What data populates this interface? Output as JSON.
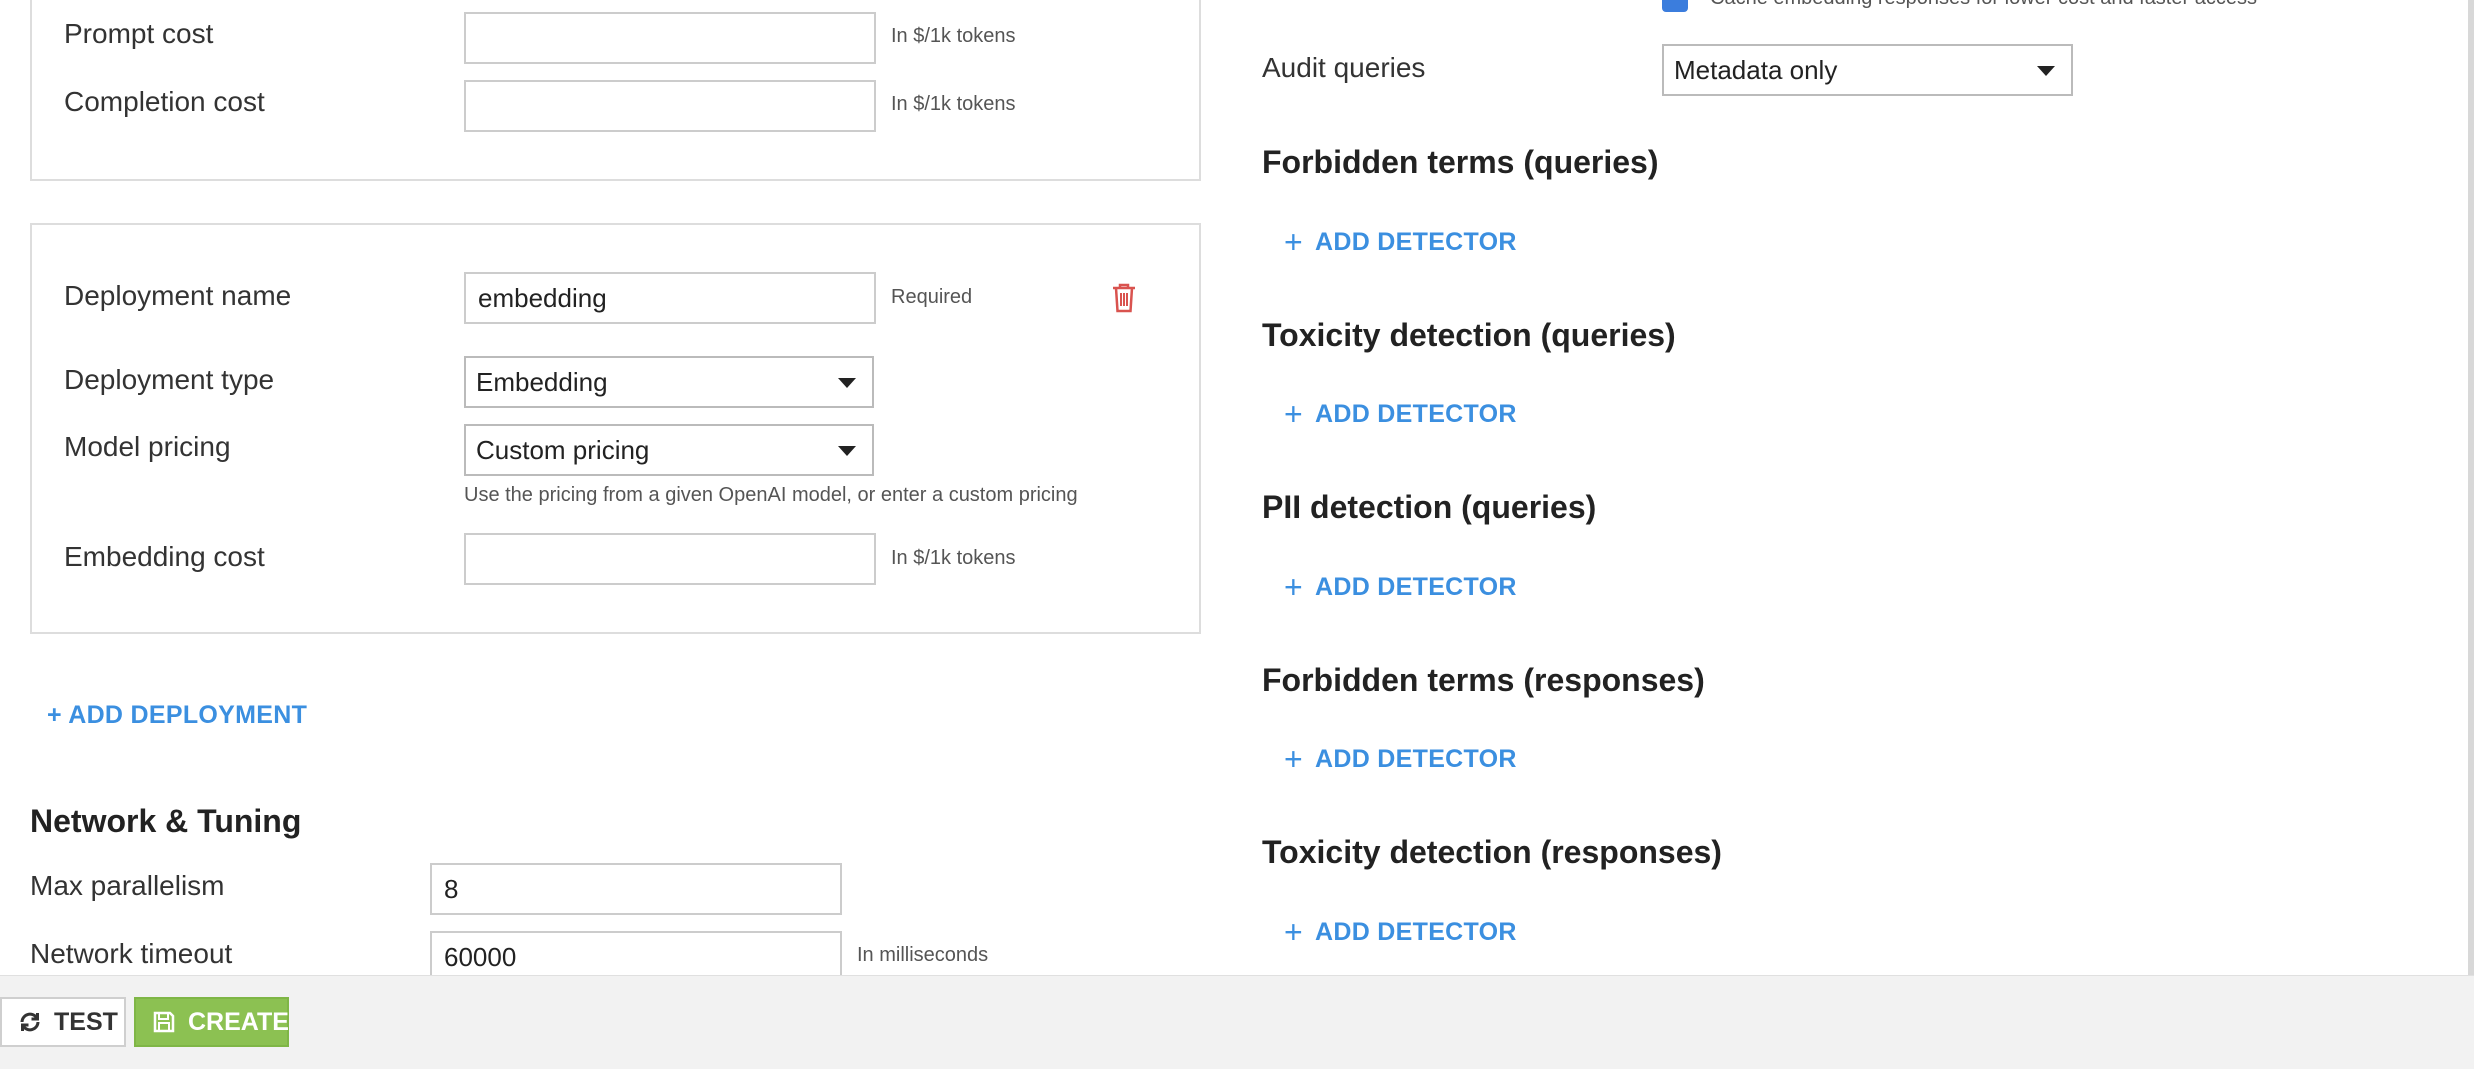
{
  "pricing_top": {
    "prompt_cost_label": "Prompt cost",
    "prompt_cost_value": "",
    "prompt_cost_hint": "In $/1k tokens",
    "completion_cost_label": "Completion cost",
    "completion_cost_value": "",
    "completion_cost_hint": "In $/1k tokens"
  },
  "deployment": {
    "name_label": "Deployment name",
    "name_value": "embedding",
    "name_hint": "Required",
    "type_label": "Deployment type",
    "type_value": "Embedding",
    "pricing_label": "Model pricing",
    "pricing_value": "Custom pricing",
    "pricing_help": "Use the pricing from a given OpenAI model, or enter a custom pricing",
    "embedding_cost_label": "Embedding cost",
    "embedding_cost_value": "",
    "embedding_cost_hint": "In $/1k tokens"
  },
  "add_deployment_label": "+ ADD DEPLOYMENT",
  "network": {
    "heading": "Network & Tuning",
    "max_parallelism_label": "Max parallelism",
    "max_parallelism_value": "8",
    "timeout_label": "Network timeout",
    "timeout_value": "60000",
    "timeout_hint": "In milliseconds"
  },
  "right": {
    "cache_checkbox_label": "Cache embedding responses for lower cost and faster access",
    "audit_label": "Audit queries",
    "audit_value": "Metadata only",
    "sections": [
      {
        "heading": "Forbidden terms (queries)",
        "action": "ADD DETECTOR"
      },
      {
        "heading": "Toxicity detection (queries)",
        "action": "ADD DETECTOR"
      },
      {
        "heading": "PII detection (queries)",
        "action": "ADD DETECTOR"
      },
      {
        "heading": "Forbidden terms (responses)",
        "action": "ADD DETECTOR"
      },
      {
        "heading": "Toxicity detection (responses)",
        "action": "ADD DETECTOR"
      }
    ]
  },
  "footer": {
    "test_label": "TEST",
    "create_label": "CREATE"
  },
  "colors": {
    "accent": "#3b8fe0",
    "create_button": "#8cc152",
    "delete_icon": "#d9534f",
    "checkbox": "#3b7ddd"
  },
  "icons": {
    "delete": "trash-icon",
    "test": "refresh-icon",
    "create": "save-icon",
    "add": "plus-icon",
    "dropdown": "caret-down-icon"
  }
}
